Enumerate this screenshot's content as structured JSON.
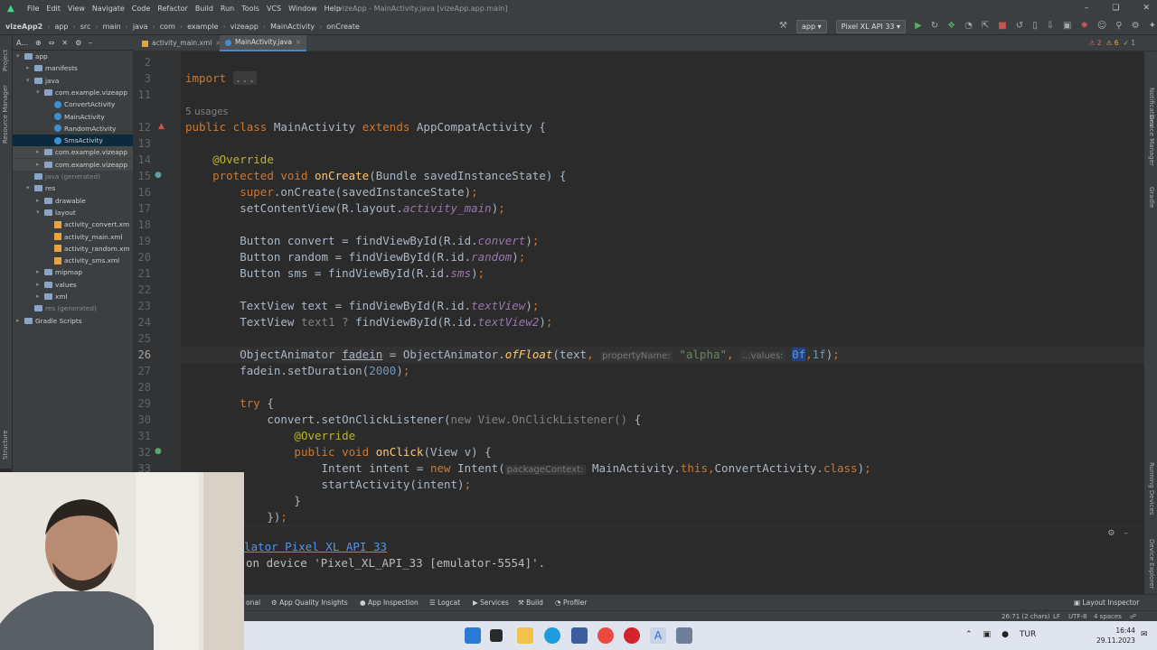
{
  "menu": {
    "items": [
      "File",
      "Edit",
      "View",
      "Navigate",
      "Code",
      "Refactor",
      "Build",
      "Run",
      "Tools",
      "VCS",
      "Window",
      "Help"
    ],
    "title": "vizeApp - MainActivity.java [vizeApp.app.main]"
  },
  "breadcrumbs": [
    "vizeApp2",
    "app",
    "src",
    "main",
    "java",
    "com",
    "example",
    "vizeapp",
    "MainActivity",
    "onCreate"
  ],
  "run": {
    "config": "app",
    "device": "Pixel XL API 33"
  },
  "project": {
    "header": "A..."
  },
  "tree": [
    {
      "label": "app",
      "indent": 0,
      "kind": "folder",
      "arrow": "v"
    },
    {
      "label": "manifests",
      "indent": 1,
      "kind": "folder",
      "arrow": ">"
    },
    {
      "label": "java",
      "indent": 1,
      "kind": "folder",
      "arrow": "v"
    },
    {
      "label": "com.example.vizeapp",
      "indent": 2,
      "kind": "folder",
      "arrow": "v"
    },
    {
      "label": "ConvertActivity",
      "indent": 3,
      "kind": "class",
      "arrow": ""
    },
    {
      "label": "MainActivity",
      "indent": 3,
      "kind": "class",
      "arrow": ""
    },
    {
      "label": "RandomActivity",
      "indent": 3,
      "kind": "class",
      "arrow": ""
    },
    {
      "label": "SmsActivity",
      "indent": 3,
      "kind": "class",
      "arrow": "",
      "selected": true
    },
    {
      "label": "com.example.vizeapp",
      "indent": 2,
      "kind": "folder",
      "arrow": ">",
      "hl": true
    },
    {
      "label": "com.example.vizeapp",
      "indent": 2,
      "kind": "folder",
      "arrow": ">",
      "hl": true
    },
    {
      "label": "java (generated)",
      "indent": 1,
      "kind": "folder",
      "arrow": "",
      "gray": true
    },
    {
      "label": "res",
      "indent": 1,
      "kind": "folder",
      "arrow": "v"
    },
    {
      "label": "drawable",
      "indent": 2,
      "kind": "folder",
      "arrow": ">"
    },
    {
      "label": "layout",
      "indent": 2,
      "kind": "folder",
      "arrow": "v"
    },
    {
      "label": "activity_convert.xm",
      "indent": 3,
      "kind": "xml",
      "arrow": ""
    },
    {
      "label": "activity_main.xml",
      "indent": 3,
      "kind": "xml",
      "arrow": ""
    },
    {
      "label": "activity_random.xm",
      "indent": 3,
      "kind": "xml",
      "arrow": ""
    },
    {
      "label": "activity_sms.xml",
      "indent": 3,
      "kind": "xml",
      "arrow": ""
    },
    {
      "label": "mipmap",
      "indent": 2,
      "kind": "folder",
      "arrow": ">"
    },
    {
      "label": "values",
      "indent": 2,
      "kind": "folder",
      "arrow": ">"
    },
    {
      "label": "xml",
      "indent": 2,
      "kind": "folder",
      "arrow": ">"
    },
    {
      "label": "res (generated)",
      "indent": 1,
      "kind": "folder",
      "arrow": "",
      "gray": true
    },
    {
      "label": "Gradle Scripts",
      "indent": 0,
      "kind": "folder",
      "arrow": ">"
    }
  ],
  "tabs": [
    {
      "label": "activity_main.xml"
    },
    {
      "label": "MainActivity.java",
      "active": true
    }
  ],
  "inspections": {
    "errors": "2",
    "warnings": "6",
    "weak": "1"
  },
  "code_lines": [
    {
      "n": "2",
      "html": ""
    },
    {
      "n": "3",
      "html": "<span class='kw'>import</span> <span class='fold-box'>...</span>"
    },
    {
      "n": "11",
      "html": ""
    },
    {
      "n": "",
      "html": "<span class='gr' style='font-family:DejaVu Sans,sans-serif;font-size:10.5px'>5 usages</span>"
    },
    {
      "n": "12",
      "html": "<span class='kw'>public class</span> <span class='pl'>MainActivity</span> <span class='kw'>extends</span> <span class='pl'>AppCompatActivity {</span>"
    },
    {
      "n": "13",
      "html": ""
    },
    {
      "n": "14",
      "html": "    <span class='an'>@Override</span>"
    },
    {
      "n": "15",
      "html": "    <span class='kw'>protected void</span> <span class='fn'>onCreate</span><span class='pl'>(Bundle savedInstanceState) {</span>"
    },
    {
      "n": "16",
      "html": "        <span class='kw'>super</span><span class='pl'>.onCreate(savedInstanceState)</span><span class='kw'>;</span>"
    },
    {
      "n": "17",
      "html": "        <span class='pl'>setContentView(R.layout.</span><span class='it'>activity_main</span><span class='pl'>)</span><span class='kw'>;</span>"
    },
    {
      "n": "18",
      "html": ""
    },
    {
      "n": "19",
      "html": "        <span class='pl'>Button convert = findViewById(R.id.</span><span class='it'>convert</span><span class='pl'>)</span><span class='kw'>;</span>"
    },
    {
      "n": "20",
      "html": "        <span class='pl'>Button random = findViewById(R.id.</span><span class='it'>random</span><span class='pl'>)</span><span class='kw'>;</span>"
    },
    {
      "n": "21",
      "html": "        <span class='pl'>Button sms = findViewById(R.id.</span><span class='it'>sms</span><span class='pl'>)</span><span class='kw'>;</span>"
    },
    {
      "n": "22",
      "html": ""
    },
    {
      "n": "23",
      "html": "        <span class='pl'>TextView text = findViewById(R.id.</span><span class='it'>textView</span><span class='pl'>)</span><span class='kw'>;</span>"
    },
    {
      "n": "24",
      "html": "        <span class='pl'>TextView </span><span class='gr'>text1 ? </span><span class='pl'>findViewById(R.id.</span><span class='it'>textView2</span><span class='pl'>)</span><span class='kw'>;</span>"
    },
    {
      "n": "25",
      "html": ""
    },
    {
      "n": "26",
      "html": "        <span class='pl'>ObjectAnimator <u>fadein</u> = ObjectAnimator.</span><span class='it' style='color:#ffc66d'>ofFloat</span><span class='pl'>(text</span><span class='kw'>, </span><span class='hint'>propertyName:</span> <span class='st'>\"alpha\"</span><span class='kw'>, </span><span class='hint'>...values:</span> <span class='nm' style='background:#214283'>0f</span><span class='kw'>,</span><span class='nm'>1f</span><span class='pl'>)</span><span class='kw'>;</span>"
    },
    {
      "n": "27",
      "html": "        <span class='pl'>fadein.setDuration(</span><span class='nm'>2000</span><span class='pl'>)</span><span class='kw'>;</span>"
    },
    {
      "n": "28",
      "html": ""
    },
    {
      "n": "29",
      "html": "        <span class='kw'>try</span> <span class='pl'>{</span>"
    },
    {
      "n": "30",
      "html": "            <span class='pl'>convert.setOnClickListener(</span><span class='gr'>new View.OnClickListener()</span> <span class='pl'>{</span>"
    },
    {
      "n": "31",
      "html": "                <span class='an'>@Override</span>"
    },
    {
      "n": "32",
      "html": "                <span class='kw'>public void</span> <span class='fn'>onClick</span><span class='pl'>(View v) {</span>"
    },
    {
      "n": "33",
      "html": "                    <span class='pl'>Intent intent = </span><span class='kw'>new</span> <span class='pl'>Intent(</span><span class='hint'>packageContext:</span> <span class='pl'>MainActivity.</span><span class='kw'>this</span><span class='kw'>,</span><span class='pl'>ConvertActivity.</span><span class='kw'>class</span><span class='pl'>)</span><span class='kw'>;</span>"
    },
    {
      "n": "",
      "html": "                    <span class='pl'>startActivity(intent)</span><span class='kw'>;</span>"
    },
    {
      "n": "",
      "html": "                <span class='pl'>}</span>"
    },
    {
      "n": "",
      "html": "            <span class='pl'>})</span><span class='kw'>;</span>"
    }
  ],
  "console": {
    "line1": "lator Pixel XL API 33",
    "line2": "on device 'Pixel_XL_API_33 [emulator-5554]'."
  },
  "tool_tabs": [
    "onal",
    "App Quality Insights",
    "App Inspection",
    "Logcat",
    "Services",
    "Build",
    "Profiler"
  ],
  "layout_inspector": "Layout Inspector",
  "status": {
    "pos": "26:71 (2 chars)",
    "eol": "LF",
    "enc": "UTF-8",
    "indent": "4 spaces"
  },
  "taskbar": {
    "lang": "TUR",
    "time": "16:44",
    "date": "29.11.2023"
  },
  "side_labels": {
    "project": "Project",
    "resource_manager": "Resource Manager",
    "structure": "Structure",
    "notifications": "Notifications",
    "device_manager": "Device Manager",
    "gradle": "Gradle",
    "running_devices": "Running Devices",
    "device_explorer": "Device Explorer"
  }
}
